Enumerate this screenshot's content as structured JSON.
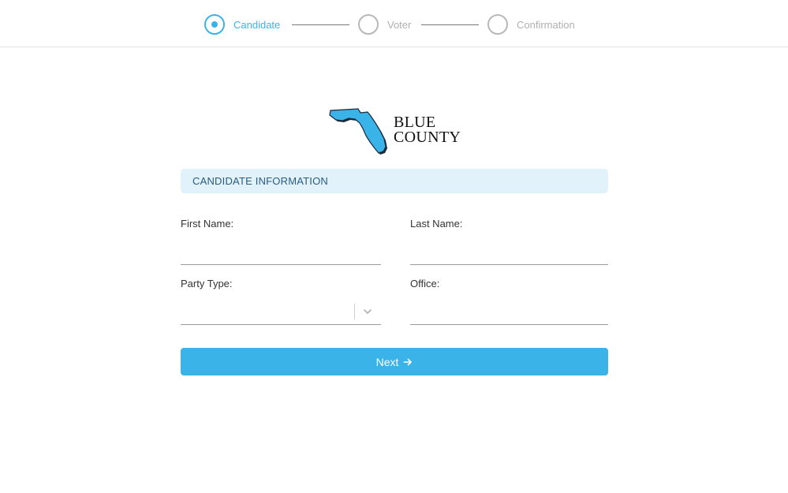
{
  "stepper": {
    "steps": [
      {
        "label": "Candidate",
        "state": "active"
      },
      {
        "label": "Voter",
        "state": "inactive"
      },
      {
        "label": "Confirmation",
        "state": "inactive"
      }
    ]
  },
  "logo": {
    "line1": "BLUE",
    "line2": "COUNTY",
    "icon": "florida-state-icon"
  },
  "form": {
    "section_title": "CANDIDATE INFORMATION",
    "first_name": {
      "label": "First Name:",
      "value": ""
    },
    "last_name": {
      "label": "Last Name:",
      "value": ""
    },
    "party_type": {
      "label": "Party Type:",
      "value": ""
    },
    "office": {
      "label": "Office:",
      "value": ""
    },
    "next_label": "Next"
  },
  "colors": {
    "accent": "#3ab4e8",
    "section_bg": "#e1f2fb",
    "section_text": "#2a5c80"
  }
}
